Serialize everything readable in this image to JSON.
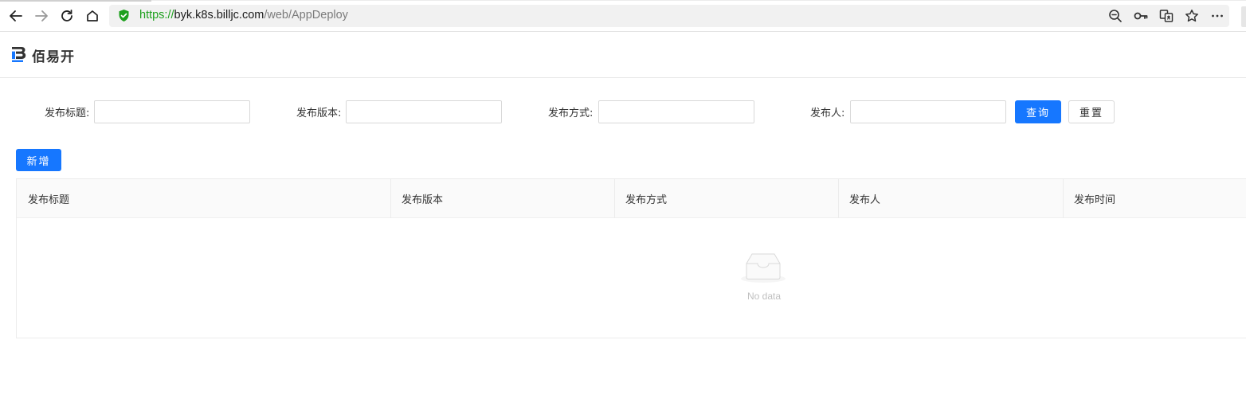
{
  "browser": {
    "url_scheme": "https://",
    "url_host": "byk.k8s.billjc.com",
    "url_path": "/web/AppDeploy",
    "icons": [
      "back-icon",
      "forward-icon",
      "reload-icon",
      "home-icon",
      "secure-shield-icon",
      "zoom-out-icon",
      "key-icon",
      "translate-icon",
      "star-icon",
      "more-icon"
    ]
  },
  "header": {
    "brand": "佰易开"
  },
  "search": {
    "title_label": "发布标题:",
    "version_label": "发布版本:",
    "method_label": "发布方式:",
    "publisher_label": "发布人:",
    "title_value": "",
    "version_value": "",
    "method_value": "",
    "publisher_value": "",
    "query_button": "查询",
    "reset_button": "重置"
  },
  "toolbar": {
    "add_button": "新增"
  },
  "table": {
    "columns": [
      "发布标题",
      "发布版本",
      "发布方式",
      "发布人",
      "发布时间"
    ],
    "rows": [],
    "empty_text": "No data"
  },
  "colors": {
    "primary": "#1677ff",
    "secure_green": "#1da01d"
  }
}
